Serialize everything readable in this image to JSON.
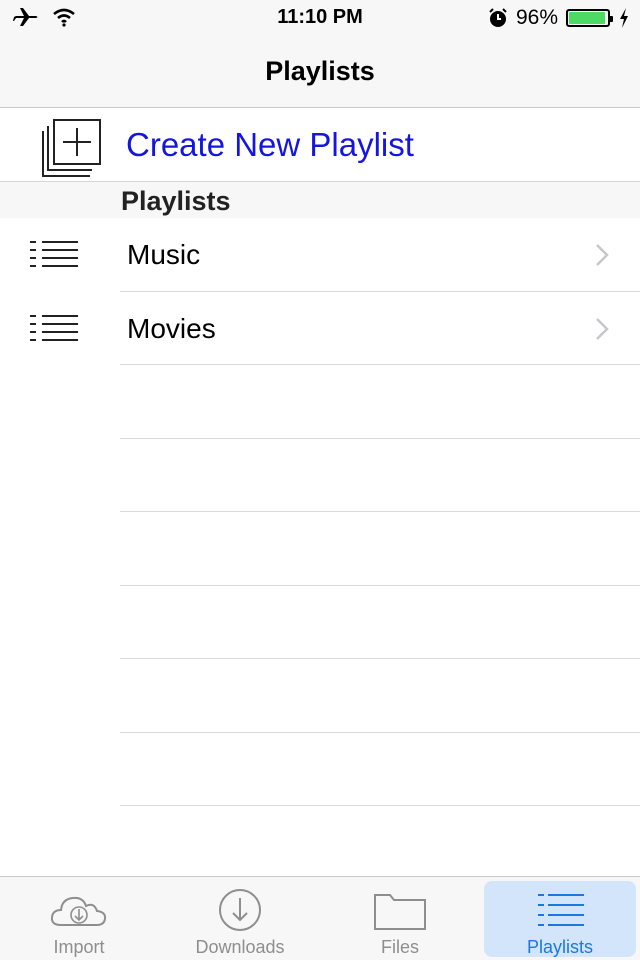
{
  "status_bar": {
    "time": "11:10 PM",
    "battery_percent_label": "96%",
    "battery_level": 0.96,
    "icons": [
      "airplane-icon",
      "wifi-icon",
      "alarm-icon",
      "battery-icon",
      "charging-bolt-icon"
    ]
  },
  "nav": {
    "title": "Playlists"
  },
  "create_row": {
    "label": "Create New Playlist",
    "icon": "add-playlist-icon",
    "color": "#1515e0"
  },
  "section": {
    "title": "Playlists"
  },
  "playlists": [
    {
      "label": "Music",
      "icon": "list-icon"
    },
    {
      "label": "Movies",
      "icon": "list-icon"
    }
  ],
  "tabs": [
    {
      "label": "Import",
      "icon": "cloud-download-icon",
      "active": false
    },
    {
      "label": "Downloads",
      "icon": "download-circle-icon",
      "active": false
    },
    {
      "label": "Files",
      "icon": "folder-icon",
      "active": false
    },
    {
      "label": "Playlists",
      "icon": "list-icon",
      "active": true
    }
  ],
  "colors": {
    "accent": "#1a78e0",
    "active_tab_bg": "#d2e5fa",
    "battery_fill": "#4cd964"
  }
}
